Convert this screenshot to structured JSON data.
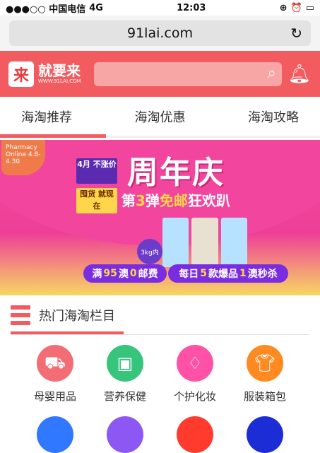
{
  "status_bar": {
    "carrier": "●●●○○ 中国电信",
    "network": "4G",
    "time": "12:03",
    "icons": [
      "orientation-lock-icon",
      "alarm-icon",
      "battery-icon"
    ]
  },
  "browser": {
    "url": "91lai.com",
    "reload_icon": "reload-icon"
  },
  "header": {
    "logo_badge": "来",
    "logo_title": "就要来",
    "logo_subtitle": "WWW.91LAI.COM",
    "search_icon": "search-icon",
    "bell_icon": "bell-icon",
    "brand_color": "#f25b5f"
  },
  "tabs": [
    {
      "label": "海淘推荐"
    },
    {
      "label": "海淘优惠"
    },
    {
      "label": "海淘攻略"
    }
  ],
  "banner": {
    "top_left_badge": "Pharmacy Online 4.8-4.30",
    "price_box_1": "4月 不涨价",
    "price_box_2": "囤货 就现在",
    "title": "周年庆",
    "subtitle_prefix": "第",
    "subtitle_number": "3",
    "subtitle_mid": "弹",
    "subtitle_highlight": "免邮",
    "subtitle_suffix": "狂欢趴",
    "weight_badge": "3kg内",
    "pill_1_prefix": "满",
    "pill_1_number": "95",
    "pill_1_mid": "澳",
    "pill_1_number2": "0",
    "pill_1_suffix": "邮费",
    "pill_2_prefix": "每日",
    "pill_2_number": "5",
    "pill_2_mid": "款爆品",
    "pill_2_number2": "1",
    "pill_2_suffix": "澳秒杀"
  },
  "section": {
    "title": "热门海淘栏目",
    "icon": "list-icon"
  },
  "categories_row_1": [
    {
      "label": "母婴用品",
      "icon": "stroller-icon",
      "color": "#f36e74"
    },
    {
      "label": "营养保健",
      "icon": "box-icon",
      "color": "#37c57b"
    },
    {
      "label": "个护化妆",
      "icon": "perfume-icon",
      "color": "#ff52a7"
    },
    {
      "label": "服装箱包",
      "icon": "shirt-icon",
      "color": "#ff8a21"
    }
  ],
  "categories_row_2": [
    {
      "icon": "circle-icon",
      "color": "#2f78ff"
    },
    {
      "icon": "circle-icon",
      "color": "#8c57f3"
    },
    {
      "icon": "circle-icon",
      "color": "#ff3b2e"
    },
    {
      "icon": "circle-icon",
      "color": "#1d2dd6"
    }
  ]
}
